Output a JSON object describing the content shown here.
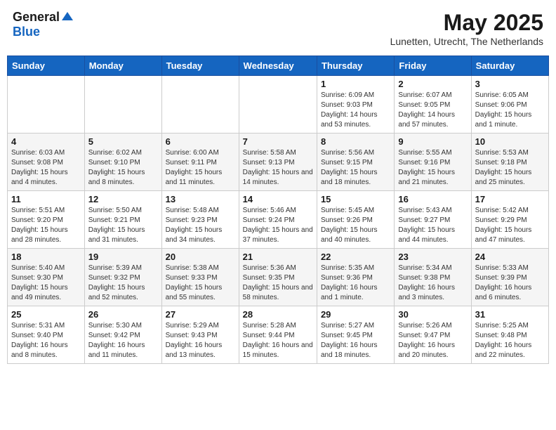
{
  "header": {
    "logo_general": "General",
    "logo_blue": "Blue",
    "month_title": "May 2025",
    "location": "Lunetten, Utrecht, The Netherlands"
  },
  "weekdays": [
    "Sunday",
    "Monday",
    "Tuesday",
    "Wednesday",
    "Thursday",
    "Friday",
    "Saturday"
  ],
  "weeks": [
    [
      {
        "day": "",
        "sunrise": "",
        "sunset": "",
        "daylight": ""
      },
      {
        "day": "",
        "sunrise": "",
        "sunset": "",
        "daylight": ""
      },
      {
        "day": "",
        "sunrise": "",
        "sunset": "",
        "daylight": ""
      },
      {
        "day": "",
        "sunrise": "",
        "sunset": "",
        "daylight": ""
      },
      {
        "day": "1",
        "sunrise": "Sunrise: 6:09 AM",
        "sunset": "Sunset: 9:03 PM",
        "daylight": "Daylight: 14 hours and 53 minutes."
      },
      {
        "day": "2",
        "sunrise": "Sunrise: 6:07 AM",
        "sunset": "Sunset: 9:05 PM",
        "daylight": "Daylight: 14 hours and 57 minutes."
      },
      {
        "day": "3",
        "sunrise": "Sunrise: 6:05 AM",
        "sunset": "Sunset: 9:06 PM",
        "daylight": "Daylight: 15 hours and 1 minute."
      }
    ],
    [
      {
        "day": "4",
        "sunrise": "Sunrise: 6:03 AM",
        "sunset": "Sunset: 9:08 PM",
        "daylight": "Daylight: 15 hours and 4 minutes."
      },
      {
        "day": "5",
        "sunrise": "Sunrise: 6:02 AM",
        "sunset": "Sunset: 9:10 PM",
        "daylight": "Daylight: 15 hours and 8 minutes."
      },
      {
        "day": "6",
        "sunrise": "Sunrise: 6:00 AM",
        "sunset": "Sunset: 9:11 PM",
        "daylight": "Daylight: 15 hours and 11 minutes."
      },
      {
        "day": "7",
        "sunrise": "Sunrise: 5:58 AM",
        "sunset": "Sunset: 9:13 PM",
        "daylight": "Daylight: 15 hours and 14 minutes."
      },
      {
        "day": "8",
        "sunrise": "Sunrise: 5:56 AM",
        "sunset": "Sunset: 9:15 PM",
        "daylight": "Daylight: 15 hours and 18 minutes."
      },
      {
        "day": "9",
        "sunrise": "Sunrise: 5:55 AM",
        "sunset": "Sunset: 9:16 PM",
        "daylight": "Daylight: 15 hours and 21 minutes."
      },
      {
        "day": "10",
        "sunrise": "Sunrise: 5:53 AM",
        "sunset": "Sunset: 9:18 PM",
        "daylight": "Daylight: 15 hours and 25 minutes."
      }
    ],
    [
      {
        "day": "11",
        "sunrise": "Sunrise: 5:51 AM",
        "sunset": "Sunset: 9:20 PM",
        "daylight": "Daylight: 15 hours and 28 minutes."
      },
      {
        "day": "12",
        "sunrise": "Sunrise: 5:50 AM",
        "sunset": "Sunset: 9:21 PM",
        "daylight": "Daylight: 15 hours and 31 minutes."
      },
      {
        "day": "13",
        "sunrise": "Sunrise: 5:48 AM",
        "sunset": "Sunset: 9:23 PM",
        "daylight": "Daylight: 15 hours and 34 minutes."
      },
      {
        "day": "14",
        "sunrise": "Sunrise: 5:46 AM",
        "sunset": "Sunset: 9:24 PM",
        "daylight": "Daylight: 15 hours and 37 minutes."
      },
      {
        "day": "15",
        "sunrise": "Sunrise: 5:45 AM",
        "sunset": "Sunset: 9:26 PM",
        "daylight": "Daylight: 15 hours and 40 minutes."
      },
      {
        "day": "16",
        "sunrise": "Sunrise: 5:43 AM",
        "sunset": "Sunset: 9:27 PM",
        "daylight": "Daylight: 15 hours and 44 minutes."
      },
      {
        "day": "17",
        "sunrise": "Sunrise: 5:42 AM",
        "sunset": "Sunset: 9:29 PM",
        "daylight": "Daylight: 15 hours and 47 minutes."
      }
    ],
    [
      {
        "day": "18",
        "sunrise": "Sunrise: 5:40 AM",
        "sunset": "Sunset: 9:30 PM",
        "daylight": "Daylight: 15 hours and 49 minutes."
      },
      {
        "day": "19",
        "sunrise": "Sunrise: 5:39 AM",
        "sunset": "Sunset: 9:32 PM",
        "daylight": "Daylight: 15 hours and 52 minutes."
      },
      {
        "day": "20",
        "sunrise": "Sunrise: 5:38 AM",
        "sunset": "Sunset: 9:33 PM",
        "daylight": "Daylight: 15 hours and 55 minutes."
      },
      {
        "day": "21",
        "sunrise": "Sunrise: 5:36 AM",
        "sunset": "Sunset: 9:35 PM",
        "daylight": "Daylight: 15 hours and 58 minutes."
      },
      {
        "day": "22",
        "sunrise": "Sunrise: 5:35 AM",
        "sunset": "Sunset: 9:36 PM",
        "daylight": "Daylight: 16 hours and 1 minute."
      },
      {
        "day": "23",
        "sunrise": "Sunrise: 5:34 AM",
        "sunset": "Sunset: 9:38 PM",
        "daylight": "Daylight: 16 hours and 3 minutes."
      },
      {
        "day": "24",
        "sunrise": "Sunrise: 5:33 AM",
        "sunset": "Sunset: 9:39 PM",
        "daylight": "Daylight: 16 hours and 6 minutes."
      }
    ],
    [
      {
        "day": "25",
        "sunrise": "Sunrise: 5:31 AM",
        "sunset": "Sunset: 9:40 PM",
        "daylight": "Daylight: 16 hours and 8 minutes."
      },
      {
        "day": "26",
        "sunrise": "Sunrise: 5:30 AM",
        "sunset": "Sunset: 9:42 PM",
        "daylight": "Daylight: 16 hours and 11 minutes."
      },
      {
        "day": "27",
        "sunrise": "Sunrise: 5:29 AM",
        "sunset": "Sunset: 9:43 PM",
        "daylight": "Daylight: 16 hours and 13 minutes."
      },
      {
        "day": "28",
        "sunrise": "Sunrise: 5:28 AM",
        "sunset": "Sunset: 9:44 PM",
        "daylight": "Daylight: 16 hours and 15 minutes."
      },
      {
        "day": "29",
        "sunrise": "Sunrise: 5:27 AM",
        "sunset": "Sunset: 9:45 PM",
        "daylight": "Daylight: 16 hours and 18 minutes."
      },
      {
        "day": "30",
        "sunrise": "Sunrise: 5:26 AM",
        "sunset": "Sunset: 9:47 PM",
        "daylight": "Daylight: 16 hours and 20 minutes."
      },
      {
        "day": "31",
        "sunrise": "Sunrise: 5:25 AM",
        "sunset": "Sunset: 9:48 PM",
        "daylight": "Daylight: 16 hours and 22 minutes."
      }
    ]
  ]
}
